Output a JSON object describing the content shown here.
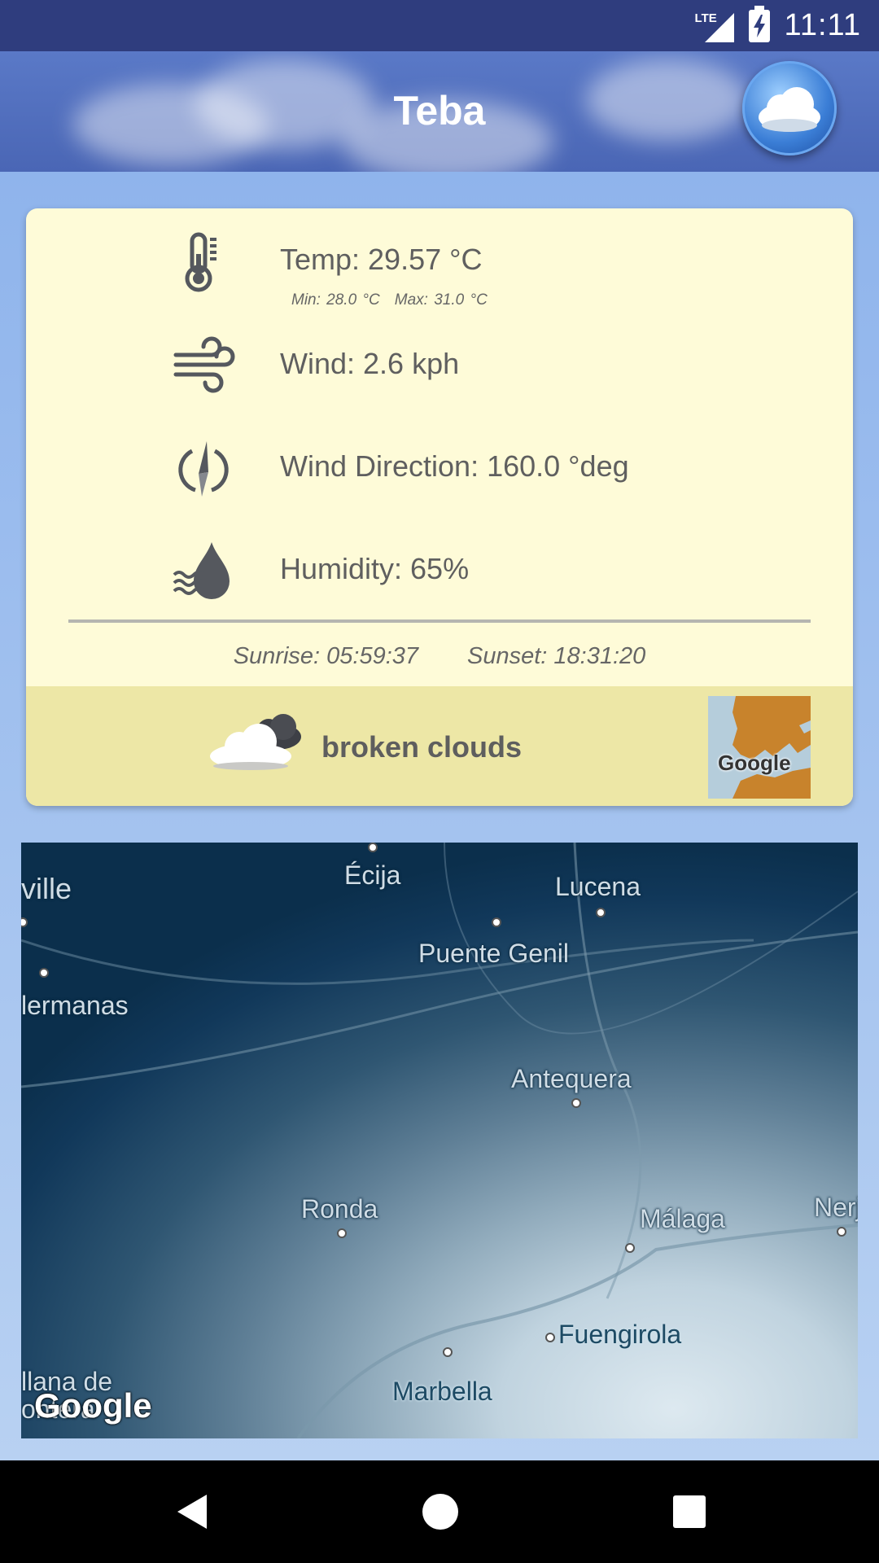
{
  "status": {
    "network": "LTE",
    "time": "11:11"
  },
  "app": {
    "title": "Teba"
  },
  "weather": {
    "temp": "Temp: 29.57 °C",
    "min": "Min: 28.0 °C",
    "max": "Max: 31.0 °C",
    "wind": "Wind: 2.6 kph",
    "wind_direction": "Wind Direction: 160.0 °deg",
    "humidity": "Humidity: 65%",
    "sunrise": "Sunrise: 05:59:37",
    "sunset": "Sunset: 18:31:20",
    "description": "broken clouds"
  },
  "minimap": {
    "logo": "Google"
  },
  "map": {
    "logo": "Google",
    "cities": [
      "ville",
      "Écija",
      "Lucena",
      "Puente Genil",
      "lermanas",
      "Antequera",
      "Ronda",
      "Málaga",
      "Nerj",
      "Fuengirola",
      "Marbella",
      "llana de",
      "ontera"
    ]
  },
  "icons": {
    "temp": "thermometer-icon",
    "wind": "wind-icon",
    "direction": "compass-icon",
    "humidity": "humidity-drop-icon",
    "weather": "broken-clouds-icon",
    "fab": "cloud-icon"
  }
}
